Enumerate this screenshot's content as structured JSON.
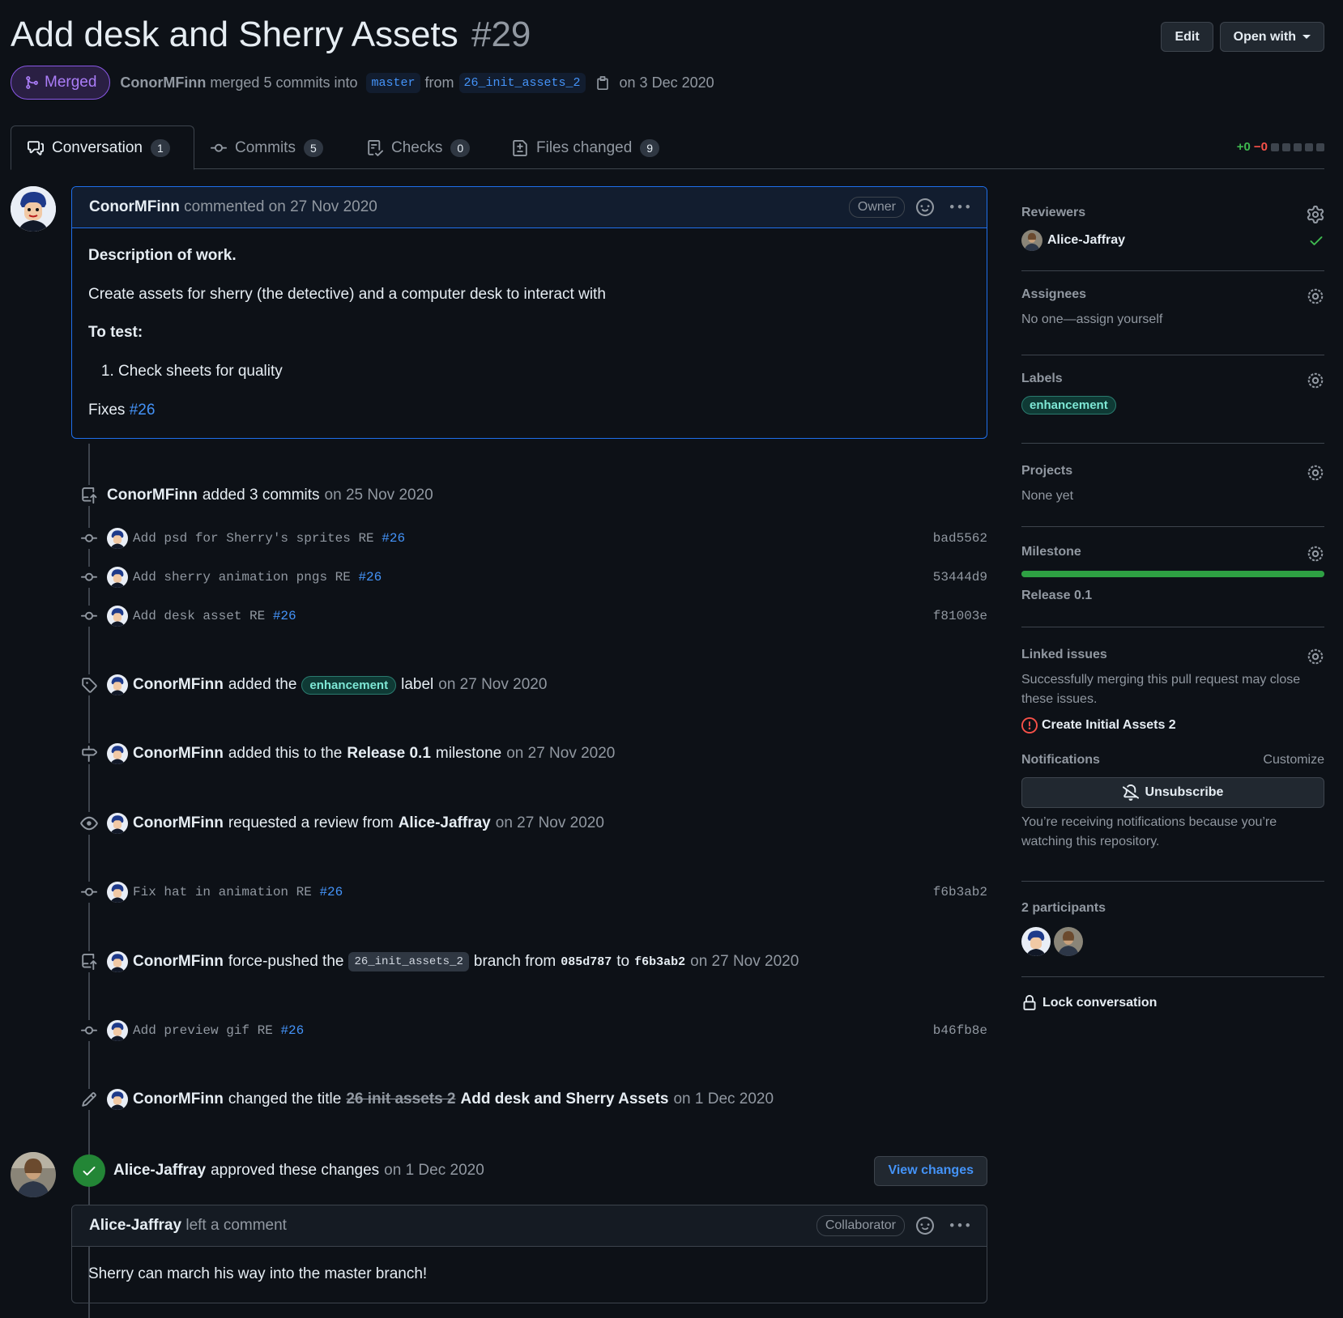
{
  "header": {
    "title": "Add desk and Sherry Assets",
    "number": "#29",
    "edit_label": "Edit",
    "open_with_label": "Open with",
    "state": "Merged",
    "author": "ConorMFinn",
    "merged_text": "merged 5 commits into",
    "base_branch": "master",
    "from_text": "from",
    "head_branch": "26_init_assets_2",
    "date_text": "on 3 Dec 2020"
  },
  "tabs": [
    {
      "label": "Conversation",
      "count": "1"
    },
    {
      "label": "Commits",
      "count": "5"
    },
    {
      "label": "Checks",
      "count": "0"
    },
    {
      "label": "Files changed",
      "count": "9"
    }
  ],
  "diffstat": {
    "add": "+0",
    "del": "−0"
  },
  "comment1": {
    "author": "ConorMFinn",
    "action": "commented on 27 Nov 2020",
    "role": "Owner",
    "heading1": "Description of work.",
    "para1": "Create assets for sherry (the detective) and a computer desk to interact with",
    "heading2": "To test:",
    "list_item": "Check sheets for quality",
    "fixes_label": "Fixes",
    "fixes_ref": "#26"
  },
  "events": {
    "added_commits": {
      "user": "ConorMFinn",
      "text": "added 3 commits",
      "date": "on 25 Nov 2020"
    },
    "commits": [
      {
        "msg": "Add psd for Sherry's sprites RE ",
        "ref": "#26",
        "sha": "bad5562"
      },
      {
        "msg": "Add sherry animation pngs RE ",
        "ref": "#26",
        "sha": "53444d9"
      },
      {
        "msg": "Add desk asset RE ",
        "ref": "#26",
        "sha": "f81003e"
      }
    ],
    "label_event": {
      "user": "ConorMFinn",
      "pre": "added the",
      "label": "enhancement",
      "post": "label",
      "date": "on 27 Nov 2020"
    },
    "milestone_event": {
      "user": "ConorMFinn",
      "pre": "added this to the",
      "milestone": "Release 0.1",
      "post": "milestone",
      "date": "on 27 Nov 2020"
    },
    "review_event": {
      "user": "ConorMFinn",
      "pre": "requested a review from",
      "reviewer": "Alice-Jaffray",
      "date": "on 27 Nov 2020"
    },
    "commit4": {
      "msg": "Fix hat in animation RE ",
      "ref": "#26",
      "sha": "f6b3ab2"
    },
    "force_push": {
      "user": "ConorMFinn",
      "pre": "force-pushed the",
      "branch": "26_init_assets_2",
      "mid": "branch from",
      "from_sha": "085d787",
      "to": "to",
      "to_sha": "f6b3ab2",
      "date": "on 27 Nov 2020"
    },
    "commit5": {
      "msg": "Add preview gif RE ",
      "ref": "#26",
      "sha": "b46fb8e"
    },
    "title_change": {
      "user": "ConorMFinn",
      "pre": "changed the title",
      "old": "26 init assets 2",
      "new": "Add desk and Sherry Assets",
      "date": "on 1 Dec 2020"
    },
    "approval": {
      "user": "Alice-Jaffray",
      "text": "approved these changes",
      "date": "on 1 Dec 2020",
      "button": "View changes"
    }
  },
  "comment2": {
    "author": "Alice-Jaffray",
    "action": "left a comment",
    "role": "Collaborator",
    "body": "Sherry can march his way into the master branch!"
  },
  "sidebar": {
    "reviewers_title": "Reviewers",
    "reviewer": "Alice-Jaffray",
    "assignees_title": "Assignees",
    "assignees_text": "No one—assign yourself",
    "labels_title": "Labels",
    "label": "enhancement",
    "projects_title": "Projects",
    "projects_text": "None yet",
    "milestone_title": "Milestone",
    "milestone_progress": 1.0,
    "milestone_name": "Release 0.1",
    "linked_title": "Linked issues",
    "linked_text": "Successfully merging this pull request may close these issues.",
    "linked_issue": "Create Initial Assets 2",
    "notif_title": "Notifications",
    "customize": "Customize",
    "unsubscribe": "Unsubscribe",
    "notif_text": "You’re receiving notifications because you’re watching this repository.",
    "participants_title": "2 participants",
    "lock": "Lock conversation"
  },
  "colors": {
    "merged": "#8957e5",
    "link": "#4493f8",
    "success": "#2ea043",
    "danger": "#f85149"
  }
}
